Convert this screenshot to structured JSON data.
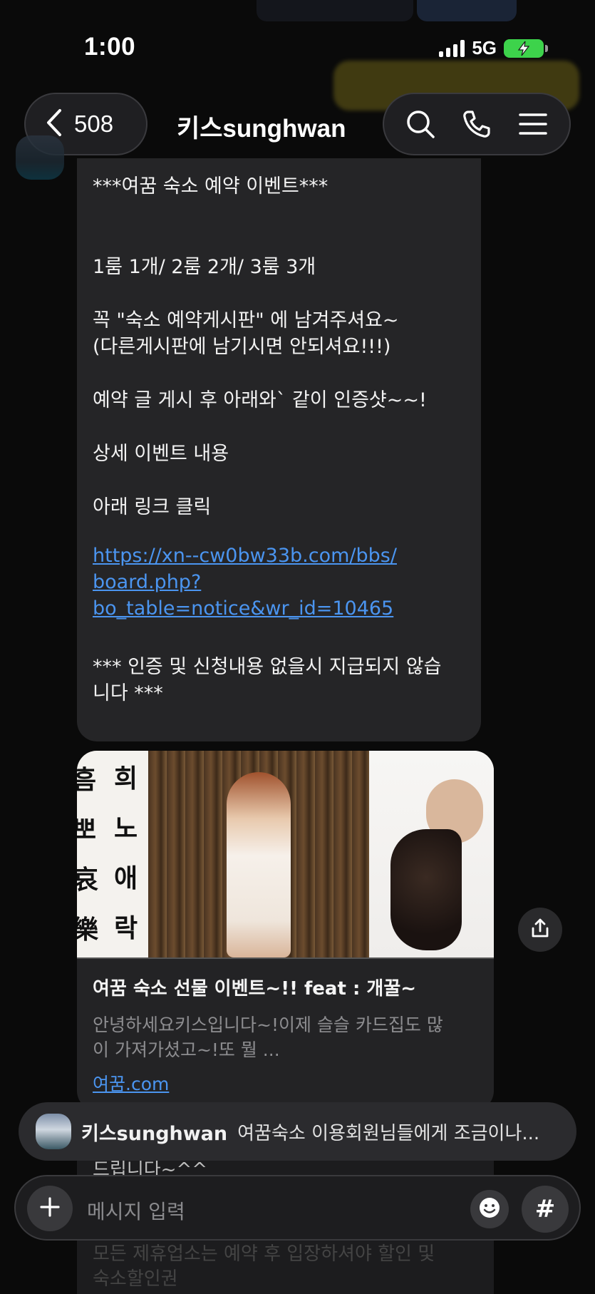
{
  "status_bar": {
    "time": "1:00",
    "network": "5G"
  },
  "header": {
    "back_count": "508",
    "title": "키스sunghwan"
  },
  "message": {
    "lines": [
      "***여꿈 숙소 예약 이벤트***",
      "1룸 1개/ 2룸 2개/ 3룸 3개",
      "꼭  \"숙소 예약게시판\" 에 남겨주셔요~",
      "(다른게시판에 남기시면 안되셔요!!!)",
      "예약 글 게시 후 아래와` 같이 인증샷~~!",
      "상세 이벤트 내용",
      "아래 링크 클릭",
      "https://xn--cw0bw33b.com/bbs/",
      "board.php?",
      "bo_table=notice&wr_id=10465",
      "*** 인증 및 신청내용 없을시 지급되지 않습",
      "니다 ***"
    ]
  },
  "link_preview": {
    "image_chars": [
      "흠",
      "희",
      "뽀",
      "노",
      "哀",
      "애",
      "樂",
      "락"
    ],
    "title": "여꿈 숙소 선물 이벤트~!! feat : 개꿀~",
    "desc_line1": "안녕하세요키스입니다~!이제 슬슬 카드집도 많",
    "desc_line2": "이 가져가셨고~!또 뭘 ...",
    "url": "여꿈.com"
  },
  "lower_message": {
    "lines": [
      "드립니다~^^",
      "모든 제휴업소는 예약 후 입장하셔야 할인 및",
      "숙소할인권"
    ]
  },
  "notification": {
    "sender": "키스sunghwan",
    "text": "여꿈숙소 이용회원님들에게 조금이나..."
  },
  "composer": {
    "placeholder": "메시지 입력",
    "hash_label": "#"
  },
  "colors": {
    "link": "#4b95f0",
    "bubble": "#252527",
    "background": "#0a0a0a",
    "battery": "#3dd34b"
  }
}
